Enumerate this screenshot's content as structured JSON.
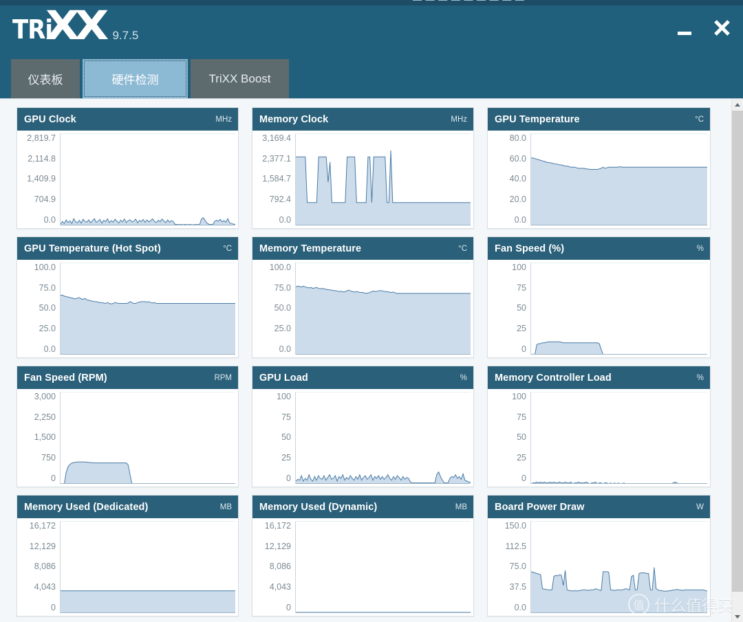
{
  "window": {
    "clipped_top_text": "— — — —   — — — — —",
    "app_name": "TRiXX",
    "logo_part1": "TRi",
    "logo_part2": "XX",
    "version": "9.7.5",
    "minimize_label": "—",
    "close_label": "✕"
  },
  "tabs": [
    {
      "label": "仪表板",
      "active": false
    },
    {
      "label": "硬件检测",
      "active": true
    },
    {
      "label": "TriXX Boost",
      "active": false
    }
  ],
  "colors": {
    "titlebar": "#21607d",
    "panel_header": "#2a6079",
    "active_tab": "#8cb9d4",
    "inactive_tab": "#5d6a6e",
    "chart_line": "#4a7ba7",
    "chart_fill": "#ccdcea",
    "content_bg": "#f4f7f9",
    "axis_text": "#7b8a93"
  },
  "scrollbar": {
    "up_arrow": "up-arrow",
    "down_arrow": "down-arrow",
    "position": "top"
  },
  "watermark": {
    "badge": "值",
    "text": "什么值得买"
  },
  "chart_data": [
    {
      "type": "area",
      "title": "GPU Clock",
      "unit": "MHz",
      "ylabel": "MHz",
      "ticks": [
        "2,819.7",
        "2,114.8",
        "1,409.9",
        "704.9",
        "0.0"
      ],
      "ylim": [
        0,
        2819.7
      ],
      "grid": false,
      "values": [
        40,
        120,
        60,
        170,
        90,
        140,
        60,
        210,
        110,
        80,
        160,
        70,
        190,
        120,
        100,
        175,
        80,
        145,
        210,
        95,
        130,
        185,
        70,
        160,
        115,
        205,
        85,
        150,
        100,
        190,
        130,
        75,
        165,
        110,
        200,
        90,
        145,
        175,
        105,
        135,
        195,
        80,
        155,
        120,
        185,
        95,
        170,
        110,
        150,
        205,
        125,
        90,
        160,
        115,
        195,
        140,
        85,
        170,
        100,
        150,
        120,
        35,
        30,
        25,
        28,
        22,
        30,
        26,
        24,
        28,
        22,
        25,
        30,
        27,
        24,
        200,
        240,
        150,
        70,
        35,
        30,
        28,
        120,
        160,
        130,
        190,
        110,
        150,
        100,
        210,
        80,
        60,
        40,
        35
      ]
    },
    {
      "type": "area",
      "title": "Memory Clock",
      "unit": "MHz",
      "ylabel": "MHz",
      "ticks": [
        "3,169.4",
        "2,377.1",
        "1,584.7",
        "792.4",
        "0.0"
      ],
      "ylim": [
        0,
        3169.4
      ],
      "grid": false,
      "values": [
        2377,
        2377,
        2377,
        2377,
        2377,
        2377,
        792,
        792,
        792,
        792,
        792,
        792,
        2377,
        2377,
        2377,
        2377,
        2377,
        1500,
        2200,
        792,
        792,
        792,
        792,
        792,
        792,
        792,
        792,
        2377,
        2377,
        2377,
        2377,
        2377,
        792,
        792,
        792,
        792,
        792,
        792,
        2377,
        2377,
        792,
        2377,
        2377,
        2377,
        2377,
        2377,
        2377,
        2377,
        792,
        792,
        2600,
        792,
        792,
        792,
        792,
        792,
        792,
        792,
        792,
        792,
        792,
        792,
        792,
        792,
        792,
        792,
        792,
        792,
        792,
        792,
        792,
        792,
        792,
        792,
        792,
        792,
        792,
        792,
        792,
        792,
        792,
        792,
        792,
        792,
        792,
        792,
        792,
        792,
        792,
        792,
        792,
        792,
        792
      ]
    },
    {
      "type": "area",
      "title": "GPU Temperature",
      "unit": "°C",
      "ylabel": "°C",
      "ticks": [
        "80.0",
        "60.0",
        "40.0",
        "20.0",
        "0.0"
      ],
      "ylim": [
        0,
        80
      ],
      "grid": false,
      "values": [
        59,
        59,
        58.5,
        58,
        57.5,
        57,
        56.5,
        56,
        55.5,
        55,
        55,
        54.5,
        54,
        54,
        53.5,
        53,
        53,
        52.5,
        52,
        52,
        51.5,
        51,
        51,
        51,
        50.5,
        50,
        50,
        50,
        50,
        49.5,
        49.5,
        49,
        49,
        49,
        49,
        49,
        49.5,
        50,
        51,
        50,
        50.5,
        51,
        51,
        51,
        51,
        51,
        51,
        51.5,
        51,
        51,
        51,
        51,
        51,
        51,
        51,
        51,
        51,
        51,
        51,
        51,
        51,
        51,
        51,
        51,
        51,
        51,
        51,
        51,
        51,
        51,
        51,
        51,
        51,
        51,
        51,
        51,
        51,
        51,
        51,
        51,
        51,
        51,
        51,
        51,
        51,
        51,
        51,
        51,
        51,
        51,
        51,
        51,
        51,
        51
      ]
    },
    {
      "type": "area",
      "title": "GPU Temperature (Hot Spot)",
      "unit": "°C",
      "ylabel": "°C",
      "ticks": [
        "100.0",
        "75.0",
        "50.0",
        "25.0",
        "0.0"
      ],
      "ylim": [
        0,
        100
      ],
      "grid": false,
      "values": [
        65,
        65,
        64,
        63.5,
        63,
        62.5,
        62,
        61.5,
        61,
        62,
        62.5,
        61,
        60.5,
        61.5,
        60,
        59.5,
        59,
        58.5,
        58,
        58,
        57.5,
        57,
        57,
        56.5,
        56,
        57,
        56,
        55.5,
        56,
        57,
        56.5,
        56,
        56,
        56,
        56,
        56,
        56.5,
        58,
        57,
        56,
        56,
        57,
        57.5,
        58,
        58,
        58,
        57.5,
        58,
        57,
        56.5,
        57,
        56,
        56,
        56,
        56,
        56,
        56,
        56,
        56,
        56,
        56,
        56,
        56,
        56,
        56,
        56,
        56,
        56,
        56,
        56,
        56,
        56,
        56,
        56,
        56,
        56,
        56,
        56,
        56,
        56,
        56,
        56,
        56,
        56,
        56,
        56,
        56,
        56,
        56,
        56,
        56,
        56,
        56,
        56
      ]
    },
    {
      "type": "area",
      "title": "Memory Temperature",
      "unit": "°C",
      "ylabel": "°C",
      "ticks": [
        "100.0",
        "75.0",
        "50.0",
        "25.0",
        "0.0"
      ],
      "ylim": [
        0,
        100
      ],
      "grid": false,
      "values": [
        74,
        75,
        74.5,
        74,
        75,
        74,
        73.5,
        73,
        73.5,
        72.5,
        73,
        73.5,
        72.5,
        72,
        72.5,
        72,
        71.5,
        71,
        71,
        70.5,
        70,
        70,
        69.5,
        69,
        69.5,
        68.5,
        69,
        70,
        70.5,
        69.5,
        69,
        68.5,
        69,
        68.5,
        68,
        68,
        67.5,
        67,
        67.5,
        68,
        69,
        69.5,
        69,
        69.5,
        70,
        70,
        69.5,
        69,
        69,
        68.5,
        68,
        68.5,
        68,
        67,
        67,
        67,
        67,
        67,
        67,
        67,
        67,
        67,
        67,
        67,
        67,
        67,
        67,
        67,
        67,
        67,
        67,
        67,
        67,
        67,
        67,
        67,
        67,
        67,
        67,
        67,
        67,
        67,
        67,
        67,
        67,
        67,
        67,
        67,
        67,
        67,
        67,
        67,
        67
      ]
    },
    {
      "type": "area",
      "title": "Fan Speed (%)",
      "unit": "%",
      "ylabel": "%",
      "ticks": [
        "100",
        "75",
        "50",
        "25",
        "0"
      ],
      "ylim": [
        0,
        100
      ],
      "grid": false,
      "values": [
        0,
        0,
        0,
        11,
        12,
        12,
        13,
        13,
        13.5,
        14,
        14,
        14,
        14,
        14,
        14,
        14,
        13.5,
        13,
        13,
        13,
        13,
        13,
        13,
        13,
        13,
        13,
        13,
        13,
        13,
        13,
        13,
        13,
        13,
        13,
        13,
        13,
        12,
        6,
        0,
        0,
        0,
        0,
        0,
        0,
        0,
        0,
        0,
        0,
        0,
        0,
        0,
        0,
        0,
        0,
        0,
        0,
        0,
        0,
        0,
        0,
        0,
        0,
        0,
        0,
        0,
        0,
        0,
        0,
        0,
        0,
        0,
        0,
        0,
        0,
        0,
        0,
        0,
        0,
        0,
        0,
        0,
        0,
        0,
        0,
        0,
        0,
        0,
        0,
        0,
        0,
        0,
        0,
        0,
        0
      ]
    },
    {
      "type": "area",
      "title": "Fan Speed (RPM)",
      "unit": "RPM",
      "ylabel": "RPM",
      "ticks": [
        "3,000",
        "2,250",
        "1,500",
        "750",
        "0"
      ],
      "ylim": [
        0,
        3000
      ],
      "grid": false,
      "values": [
        0,
        0,
        0,
        380,
        560,
        640,
        680,
        700,
        710,
        715,
        718,
        720,
        720,
        715,
        710,
        705,
        700,
        690,
        690,
        688,
        688,
        688,
        688,
        688,
        688,
        688,
        688,
        688,
        688,
        688,
        688,
        688,
        688,
        688,
        688,
        688,
        620,
        300,
        0,
        0,
        0,
        0,
        0,
        0,
        0,
        0,
        0,
        0,
        0,
        0,
        0,
        0,
        0,
        0,
        0,
        0,
        0,
        0,
        0,
        0,
        0,
        0,
        0,
        0,
        0,
        0,
        0,
        0,
        0,
        0,
        0,
        0,
        0,
        0,
        0,
        0,
        0,
        0,
        0,
        0,
        0,
        0,
        0,
        0,
        0,
        0,
        0,
        0,
        0,
        0,
        0,
        0,
        0,
        0
      ]
    },
    {
      "type": "area",
      "title": "GPU Load",
      "unit": "%",
      "ylabel": "%",
      "ticks": [
        "100",
        "75",
        "50",
        "25",
        "0"
      ],
      "ylim": [
        0,
        100
      ],
      "grid": false,
      "values": [
        3,
        5,
        4,
        9,
        3,
        6,
        4,
        10,
        5,
        3,
        8,
        4,
        9,
        6,
        5,
        9,
        4,
        7,
        10,
        5,
        6,
        9,
        3,
        8,
        6,
        10,
        4,
        7,
        5,
        9,
        6,
        4,
        8,
        5,
        10,
        4,
        7,
        9,
        5,
        7,
        10,
        4,
        8,
        6,
        9,
        5,
        8,
        5,
        7,
        10,
        6,
        4,
        8,
        5,
        9,
        7,
        4,
        8,
        5,
        7,
        6,
        2,
        1,
        1,
        1,
        1,
        1,
        1,
        1,
        1,
        1,
        1,
        1,
        1,
        1,
        10,
        13,
        8,
        4,
        1,
        1,
        1,
        6,
        8,
        7,
        10,
        6,
        8,
        5,
        11,
        4,
        3,
        2,
        2
      ]
    },
    {
      "type": "area",
      "title": "Memory Controller Load",
      "unit": "%",
      "ylabel": "%",
      "ticks": [
        "100",
        "75",
        "50",
        "25",
        "0"
      ],
      "ylim": [
        0,
        100
      ],
      "grid": false,
      "values": [
        0,
        1,
        1,
        2,
        1,
        2,
        1,
        2,
        1,
        1,
        2,
        1,
        2,
        1,
        1,
        2,
        1,
        1,
        2,
        1,
        1,
        2,
        0,
        1,
        1,
        2,
        1,
        1,
        1,
        2,
        1,
        0,
        1,
        1,
        2,
        0,
        1,
        1,
        0,
        1,
        1,
        0,
        1,
        0,
        1,
        0,
        1,
        0,
        0,
        1,
        0,
        0,
        0,
        0,
        0,
        0,
        0,
        0,
        0,
        0,
        0,
        0,
        0,
        0,
        0,
        0,
        0,
        0,
        0,
        0,
        0,
        0,
        0,
        0,
        0,
        1,
        2,
        1,
        0,
        0,
        0,
        0,
        0,
        0,
        0,
        0,
        0,
        0,
        0,
        0,
        0,
        0,
        0,
        0
      ]
    },
    {
      "type": "area",
      "title": "Memory Used (Dedicated)",
      "unit": "MB",
      "ylabel": "MB",
      "ticks": [
        "16,172",
        "12,129",
        "8,086",
        "4,043",
        "0"
      ],
      "ylim": [
        0,
        16172
      ],
      "grid": false,
      "values": [
        3930,
        3930,
        3930,
        3930,
        3930,
        3930,
        3930,
        3930,
        3930,
        3930,
        3930,
        3930,
        3930,
        3930,
        3930,
        3930,
        3930,
        3930,
        3930,
        3930,
        3930,
        3930,
        3930,
        3930,
        3930,
        3930,
        3930,
        3930,
        3930,
        3930,
        3930,
        3930,
        3930,
        3930,
        3930,
        3930,
        3930,
        3930,
        3930,
        3930,
        3930,
        3930,
        3930,
        3930,
        3930,
        3930,
        3930,
        3930,
        3930,
        3930,
        3930,
        3930,
        3930,
        3930,
        3930,
        3930,
        3930,
        3930,
        3930,
        3930,
        3930,
        3930,
        3930,
        3930,
        3930,
        3930,
        3930,
        3930,
        3930,
        3930,
        3930,
        3930,
        3930,
        3930,
        3930,
        3930,
        3930,
        3930,
        3930,
        3930,
        3930,
        3930,
        3930,
        3930,
        3930,
        3930,
        3930,
        3930,
        3930,
        3930,
        3930,
        3930,
        3930,
        3930
      ]
    },
    {
      "type": "area",
      "title": "Memory Used (Dynamic)",
      "unit": "MB",
      "ylabel": "MB",
      "ticks": [
        "16,172",
        "12,129",
        "8,086",
        "4,043",
        "0"
      ],
      "ylim": [
        0,
        16172
      ],
      "grid": false,
      "values": [
        120,
        120,
        120,
        120,
        120,
        120,
        120,
        120,
        120,
        120,
        120,
        120,
        120,
        120,
        120,
        120,
        120,
        120,
        120,
        120,
        120,
        120,
        120,
        120,
        120,
        120,
        120,
        120,
        120,
        120,
        120,
        120,
        120,
        120,
        120,
        120,
        120,
        120,
        120,
        120,
        120,
        120,
        120,
        120,
        120,
        120,
        120,
        120,
        120,
        120,
        120,
        120,
        120,
        120,
        120,
        120,
        120,
        120,
        120,
        120,
        120,
        120,
        120,
        120,
        120,
        120,
        120,
        120,
        120,
        120,
        120,
        120,
        120,
        120,
        120,
        120,
        120,
        120,
        120,
        120,
        120,
        120,
        120,
        120,
        120,
        120,
        120,
        120,
        120,
        120,
        120,
        120,
        120,
        120
      ]
    },
    {
      "type": "area",
      "title": "Board Power Draw",
      "unit": "W",
      "ylabel": "W",
      "ticks": [
        "150.0",
        "112.5",
        "75.0",
        "37.5",
        "0.0"
      ],
      "ylim": [
        0,
        150
      ],
      "grid": false,
      "values": [
        68,
        67,
        66,
        65,
        64,
        63,
        40,
        39,
        39,
        38,
        38,
        38,
        60,
        62,
        61,
        63,
        62,
        45,
        70,
        38,
        37,
        37,
        36,
        37,
        36,
        37,
        37,
        38,
        38,
        38,
        37,
        38,
        38,
        38,
        40,
        39,
        38,
        37,
        68,
        68,
        68,
        67,
        38,
        38,
        37,
        38,
        38,
        38,
        38,
        39,
        40,
        39,
        38,
        60,
        62,
        38,
        38,
        65,
        66,
        66,
        66,
        65,
        65,
        38,
        38,
        75,
        40,
        38,
        37,
        37,
        36,
        36,
        36,
        37,
        37,
        38,
        38,
        39,
        38,
        38,
        37,
        38,
        38,
        38,
        38,
        38,
        38,
        38,
        38,
        38,
        38,
        38,
        37,
        36
      ]
    }
  ]
}
